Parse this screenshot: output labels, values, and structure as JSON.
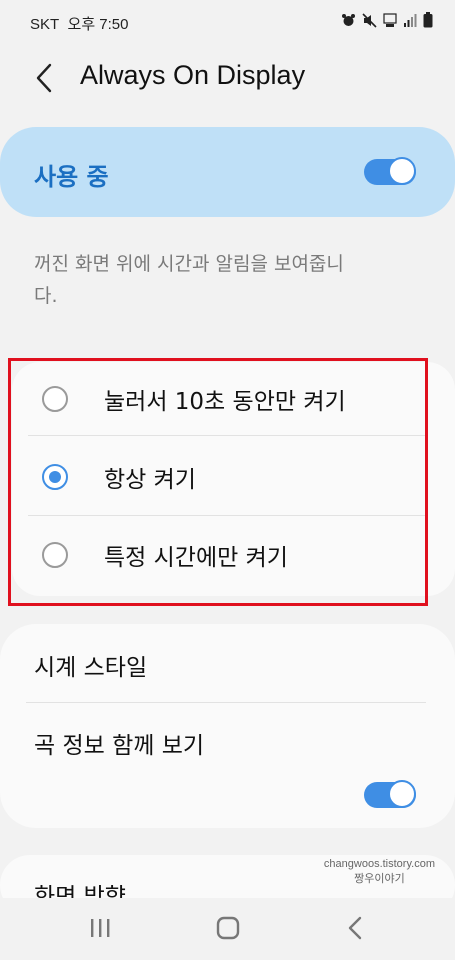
{
  "status_bar": {
    "carrier": "SKT",
    "time": "오후 7:50"
  },
  "header": {
    "title": "Always On Display"
  },
  "master_switch": {
    "label": "사용 중",
    "on": true
  },
  "description": "꺼진 화면 위에 시간과 알림을 보여줍니다.",
  "display_options": [
    {
      "label": "눌러서 10초 동안만 켜기",
      "selected": false
    },
    {
      "label": "항상 켜기",
      "selected": true
    },
    {
      "label": "특정 시간에만 켜기",
      "selected": false
    }
  ],
  "settings": {
    "clock_style": "시계 스타일",
    "music_info": {
      "label": "곡 정보 함께 보기",
      "on": true
    },
    "next_item": "화면 방향"
  },
  "watermark": {
    "line1": "changwoos.tistory.com",
    "line2": "짱우이야기"
  },
  "colors": {
    "accent": "#3f8ee4",
    "master_card": "#bfe0f7",
    "highlight": "#e0101e"
  },
  "nav_icons": [
    "recent-apps-icon",
    "home-icon",
    "back-icon"
  ]
}
